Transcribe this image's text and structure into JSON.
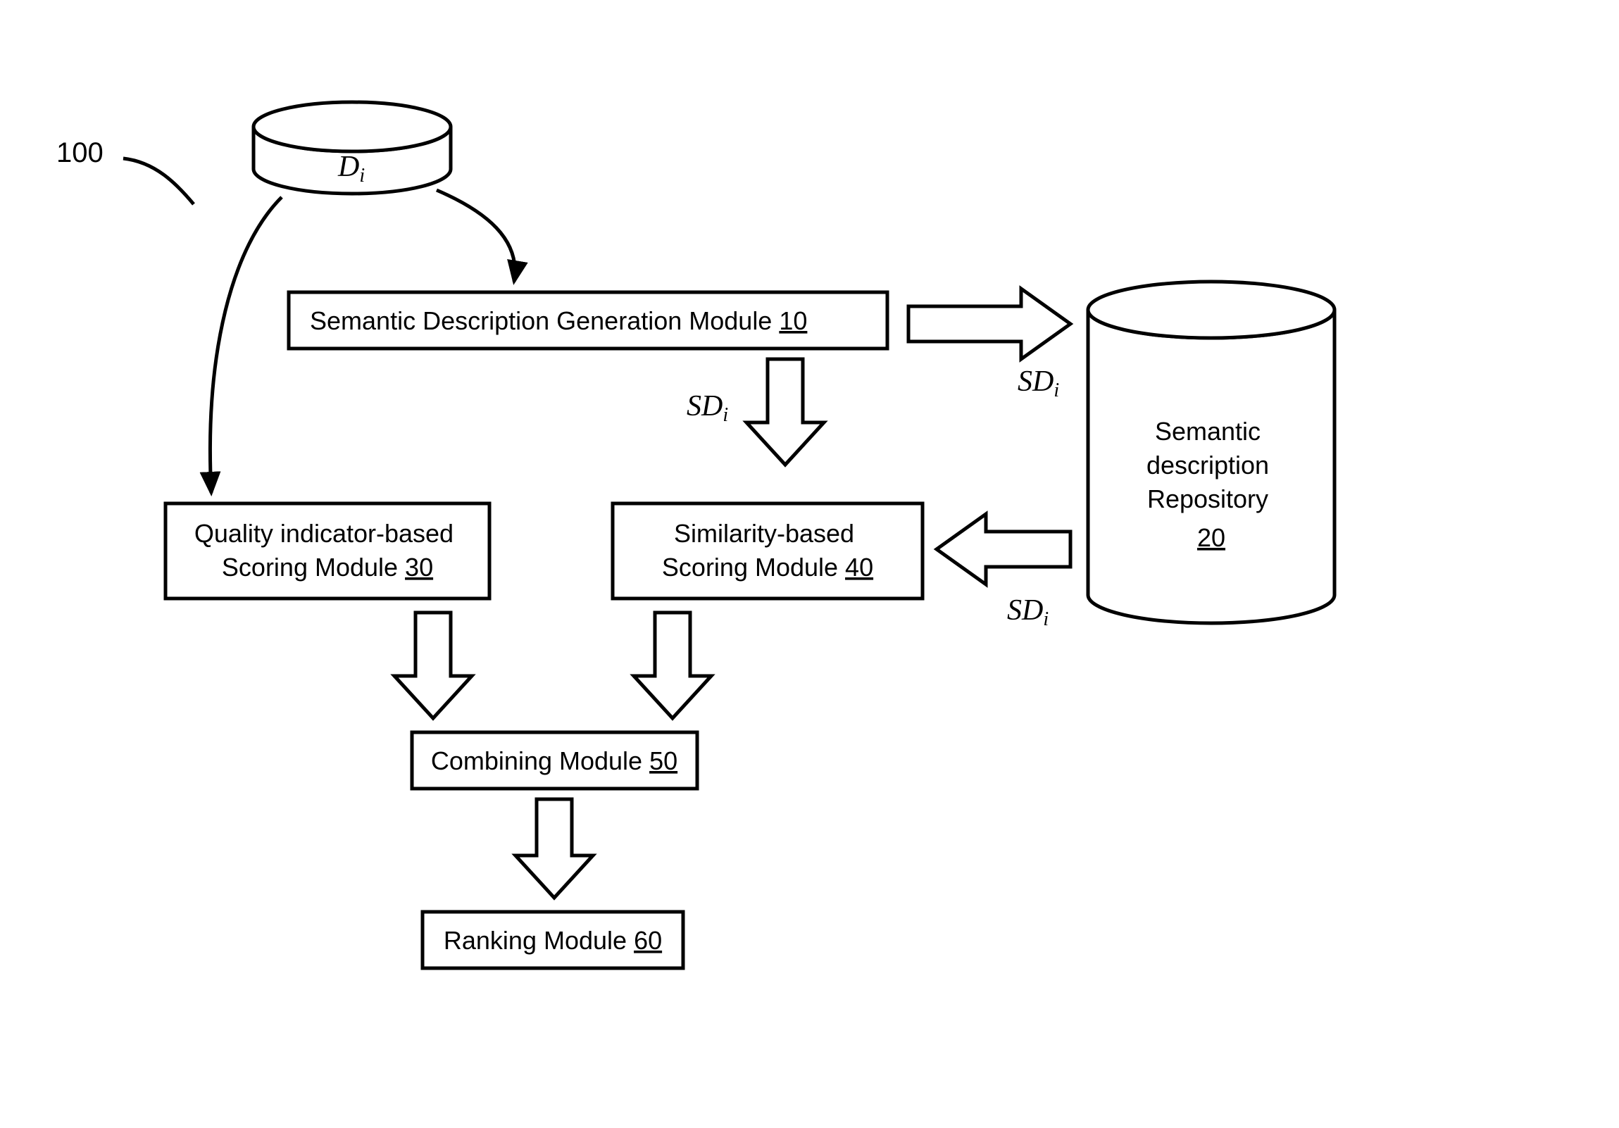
{
  "figureNumber": "100",
  "di_label": "D",
  "di_sub": "i",
  "sdi_label": "SD",
  "sdi_sub": "i",
  "boxes": {
    "semgen": {
      "text": "Semantic Description Generation Module ",
      "num": "10"
    },
    "quality": {
      "line1": "Quality indicator-based",
      "line2": "Scoring Module ",
      "num": "30"
    },
    "similarity": {
      "line1": "Similarity-based",
      "line2": "Scoring Module ",
      "num": "40"
    },
    "combining": {
      "text": "Combining Module ",
      "num": "50"
    },
    "ranking": {
      "text": "Ranking Module ",
      "num": "60"
    }
  },
  "repo": {
    "line1": "Semantic",
    "line2": "description",
    "line3": "Repository",
    "num": "20"
  }
}
